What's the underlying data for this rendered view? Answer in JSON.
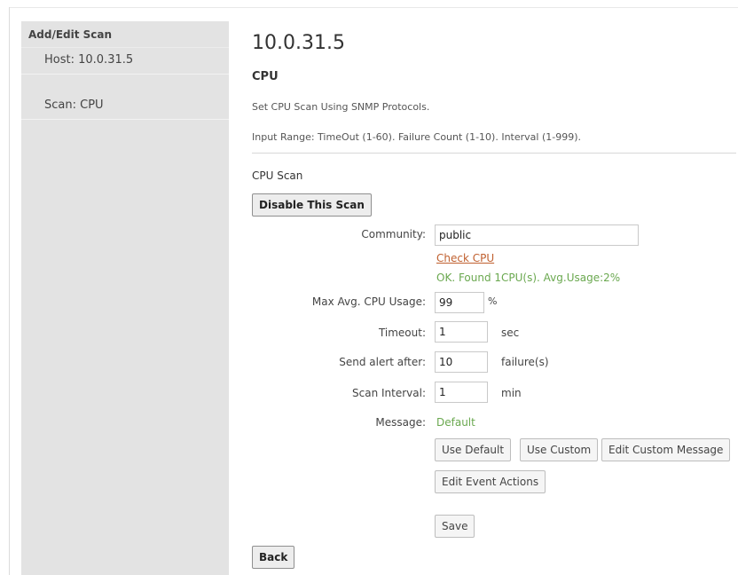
{
  "sidebar": {
    "title": "Add/Edit Scan",
    "items": [
      {
        "label": "Host: 10.0.31.5"
      },
      {
        "label": "Scan: CPU"
      }
    ]
  },
  "main": {
    "title": "10.0.31.5",
    "section_title": "CPU",
    "description": "Set CPU Scan Using SNMP Protocols.",
    "input_range": "Input Range: TimeOut (1-60). Failure Count (1-10). Interval (1-999).",
    "subsection_title": "CPU Scan",
    "disable_button": "Disable This Scan"
  },
  "form": {
    "community": {
      "label": "Community:",
      "value": "public"
    },
    "check_link": "Check CPU",
    "check_result": "OK. Found 1CPU(s). Avg.Usage:2%",
    "max_cpu": {
      "label": "Max Avg. CPU Usage:",
      "value": "99",
      "unit": "%"
    },
    "timeout": {
      "label": "Timeout:",
      "value": "1",
      "unit": "sec"
    },
    "send_alert": {
      "label": "Send alert after:",
      "value": "10",
      "unit": "failure(s)"
    },
    "scan_interval": {
      "label": "Scan Interval:",
      "value": "1",
      "unit": "min"
    },
    "message": {
      "label": "Message:",
      "value": "Default"
    }
  },
  "buttons": {
    "use_default": "Use Default",
    "use_custom": "Use Custom",
    "edit_custom_message": "Edit Custom Message",
    "edit_event_actions": "Edit Event Actions",
    "save": "Save",
    "back": "Back"
  },
  "colors": {
    "link": "#c0602f",
    "ok_green": "#6aa84f",
    "sidebar_bg": "#e3e3e3"
  }
}
